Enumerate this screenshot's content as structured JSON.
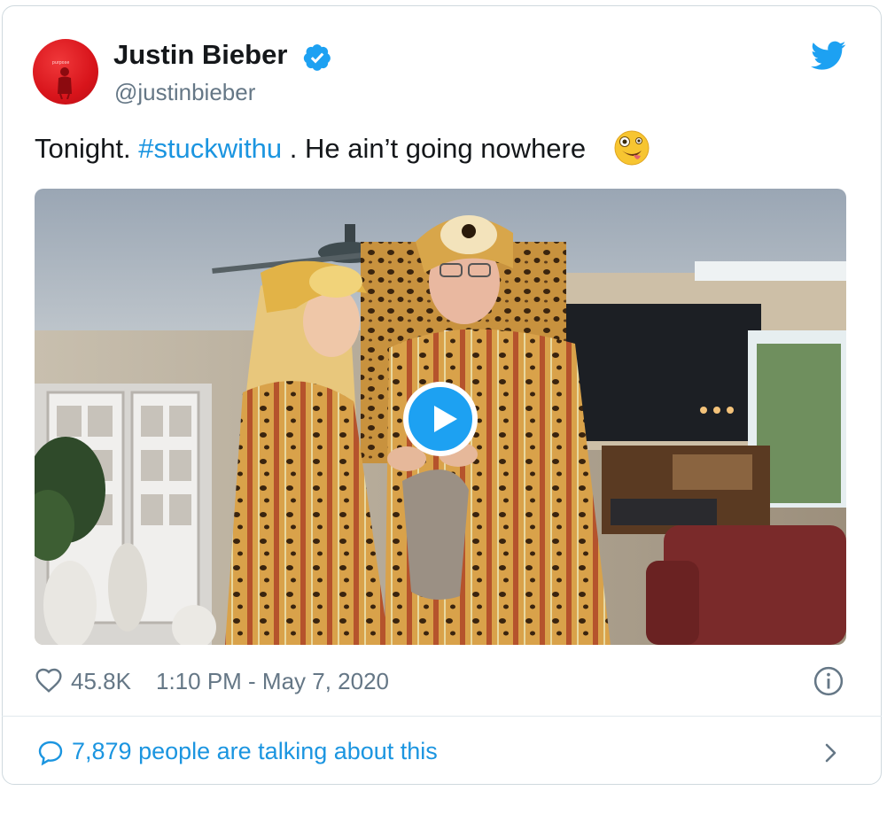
{
  "tweet": {
    "author_name": "Justin Bieber",
    "handle": "@justinbieber",
    "avatar_text": "purpose",
    "text_before": "Tonight. ",
    "hashtag": "#stuckwithu",
    "text_after": " . He ain’t going nowhere",
    "emoji": "zany-face-emoji",
    "verified_icon": "verified-badge-icon",
    "bird_icon": "twitter-bird-icon"
  },
  "media": {
    "type": "video",
    "play_icon": "play-icon",
    "description": ""
  },
  "footer": {
    "likes": "45.8K",
    "timestamp": "1:10 PM - May 7, 2020",
    "heart_icon": "heart-icon",
    "info_icon": "info-icon"
  },
  "conversation": {
    "label": "7,879 people are talking about this",
    "icon": "speech-bubble-icon",
    "chevron_icon": "chevron-right-icon"
  },
  "colors": {
    "accent": "#1da1f2",
    "link": "#1b95e0",
    "muted": "#657786",
    "avatar_red": "#d8141b"
  }
}
